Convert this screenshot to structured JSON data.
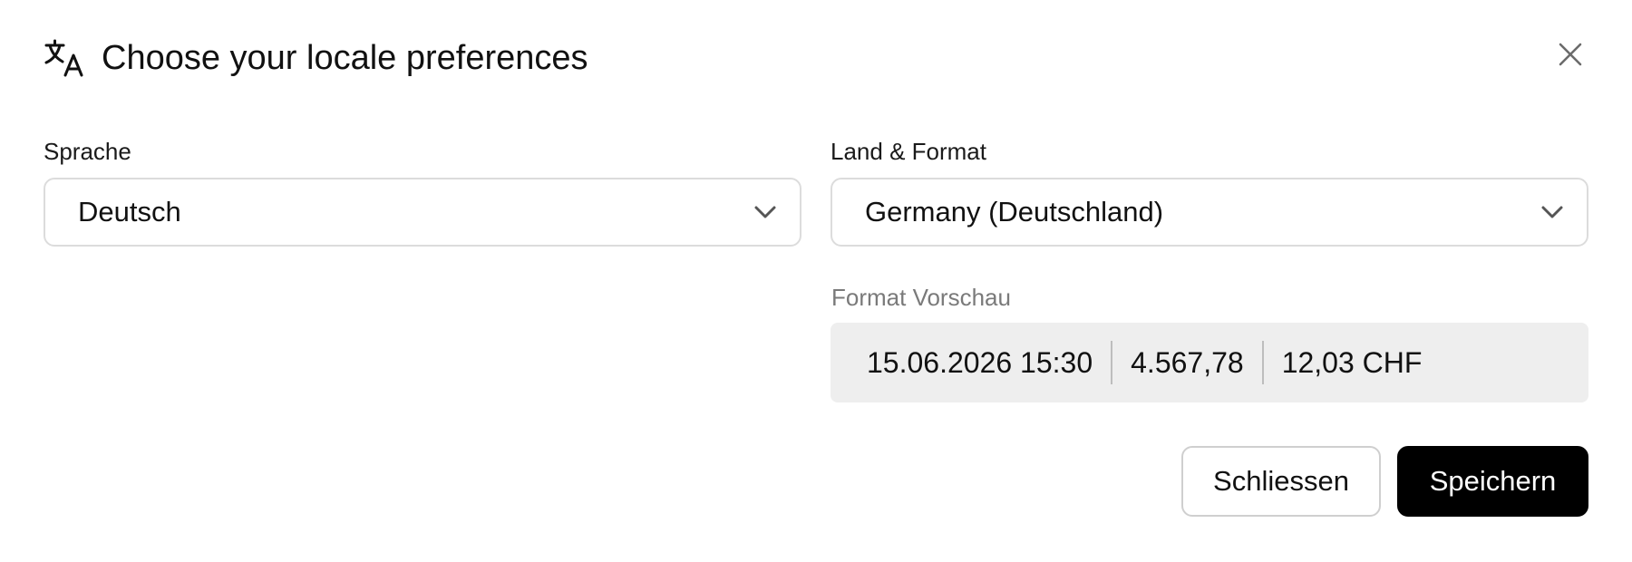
{
  "dialog": {
    "title": "Choose your locale preferences",
    "header_icon": "translate-icon",
    "close_icon": "close-icon"
  },
  "language": {
    "label": "Sprache",
    "value": "Deutsch",
    "icon": "chevron-down-icon"
  },
  "region": {
    "label": "Land & Format",
    "value": "Germany (Deutschland)",
    "icon": "chevron-down-icon"
  },
  "preview": {
    "label": "Format Vorschau",
    "date_time": "15.06.2026 15:30",
    "number": "4.567,78",
    "currency": "12,03 CHF"
  },
  "actions": {
    "close_label": "Schliessen",
    "save_label": "Speichern"
  },
  "colors": {
    "primary_button": "#000000",
    "preview_background": "#eeeeee",
    "border": "#dcdcdc"
  }
}
